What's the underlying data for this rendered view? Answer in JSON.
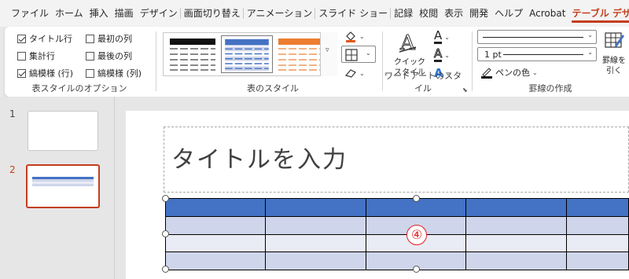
{
  "menu": {
    "tabs": [
      "ファイル",
      "ホーム",
      "挿入",
      "描画",
      "デザイン",
      "画面切り替え",
      "アニメーション",
      "スライド ショー",
      "記録",
      "校閲",
      "表示",
      "開発",
      "ヘルプ",
      "Acrobat",
      "テーブル デザイン"
    ],
    "active": "テーブル デザイン"
  },
  "ribbon": {
    "options": {
      "header_row": "タイトル行",
      "total_row": "集計行",
      "banded_rows": "縞模様 (行)",
      "first_col": "最初の列",
      "last_col": "最後の列",
      "banded_cols": "縞模様 (列)",
      "label": "表スタイルのオプション"
    },
    "styles": {
      "label": "表のスタイル"
    },
    "wordart": {
      "quick_styles": "クイック",
      "quick_styles2": "スタイル",
      "label": "ワードアートのスタイル"
    },
    "borders": {
      "pen_weight": "1 pt",
      "pen_color": "ペンの色",
      "draw_table": "罫線を",
      "draw_table2": "引く",
      "label": "罫線の作成"
    }
  },
  "thumbnails": {
    "slide1": "1",
    "slide2": "2"
  },
  "slide": {
    "title_placeholder": "タイトルを入力",
    "marker": "④"
  },
  "colors": {
    "accent": "#c43e1c",
    "table_header": "#4472c4",
    "table_band": "#cfd5ea",
    "table_band_light": "#e9ebf5"
  }
}
